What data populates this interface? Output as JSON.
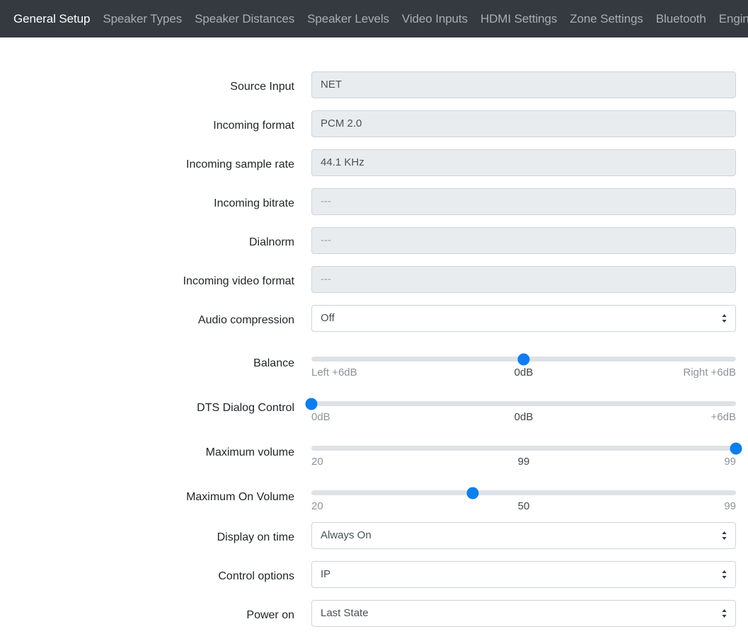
{
  "nav": {
    "items": [
      {
        "label": "General Setup",
        "active": true
      },
      {
        "label": "Speaker Types",
        "active": false
      },
      {
        "label": "Speaker Distances",
        "active": false
      },
      {
        "label": "Speaker Levels",
        "active": false
      },
      {
        "label": "Video Inputs",
        "active": false
      },
      {
        "label": "HDMI Settings",
        "active": false
      },
      {
        "label": "Zone Settings",
        "active": false
      },
      {
        "label": "Bluetooth",
        "active": false
      },
      {
        "label": "Engineering",
        "active": false
      }
    ]
  },
  "colors": {
    "navbar_bg": "#343a40",
    "accent": "#0d7ef0",
    "field_bg": "#e9ecef",
    "track": "#dee2e6"
  },
  "form": {
    "source_input": {
      "label": "Source Input",
      "value": "NET",
      "muted": false
    },
    "incoming_format": {
      "label": "Incoming format",
      "value": "PCM 2.0",
      "muted": false
    },
    "incoming_sample_rate": {
      "label": "Incoming sample rate",
      "value": "44.1 KHz",
      "muted": false
    },
    "incoming_bitrate": {
      "label": "Incoming bitrate",
      "value": "---",
      "muted": true
    },
    "dialnorm": {
      "label": "Dialnorm",
      "value": "---",
      "muted": true
    },
    "incoming_video_format": {
      "label": "Incoming video format",
      "value": "---",
      "muted": true
    },
    "audio_compression": {
      "label": "Audio compression",
      "value": "Off"
    },
    "balance": {
      "label": "Balance",
      "min_label": "Left +6dB",
      "mid_label": "0dB",
      "max_label": "Right +6dB",
      "thumb_percent": 50
    },
    "dts_dialog_control": {
      "label": "DTS Dialog Control",
      "min_label": "0dB",
      "mid_label": "0dB",
      "max_label": "+6dB",
      "thumb_percent": 0
    },
    "maximum_volume": {
      "label": "Maximum volume",
      "min_label": "20",
      "mid_label": "99",
      "max_label": "99",
      "thumb_percent": 100
    },
    "maximum_on_volume": {
      "label": "Maximum On Volume",
      "min_label": "20",
      "mid_label": "50",
      "max_label": "99",
      "thumb_percent": 38
    },
    "display_on_time": {
      "label": "Display on time",
      "value": "Always On"
    },
    "control_options": {
      "label": "Control options",
      "value": "IP"
    },
    "power_on": {
      "label": "Power on",
      "value": "Last State"
    }
  }
}
